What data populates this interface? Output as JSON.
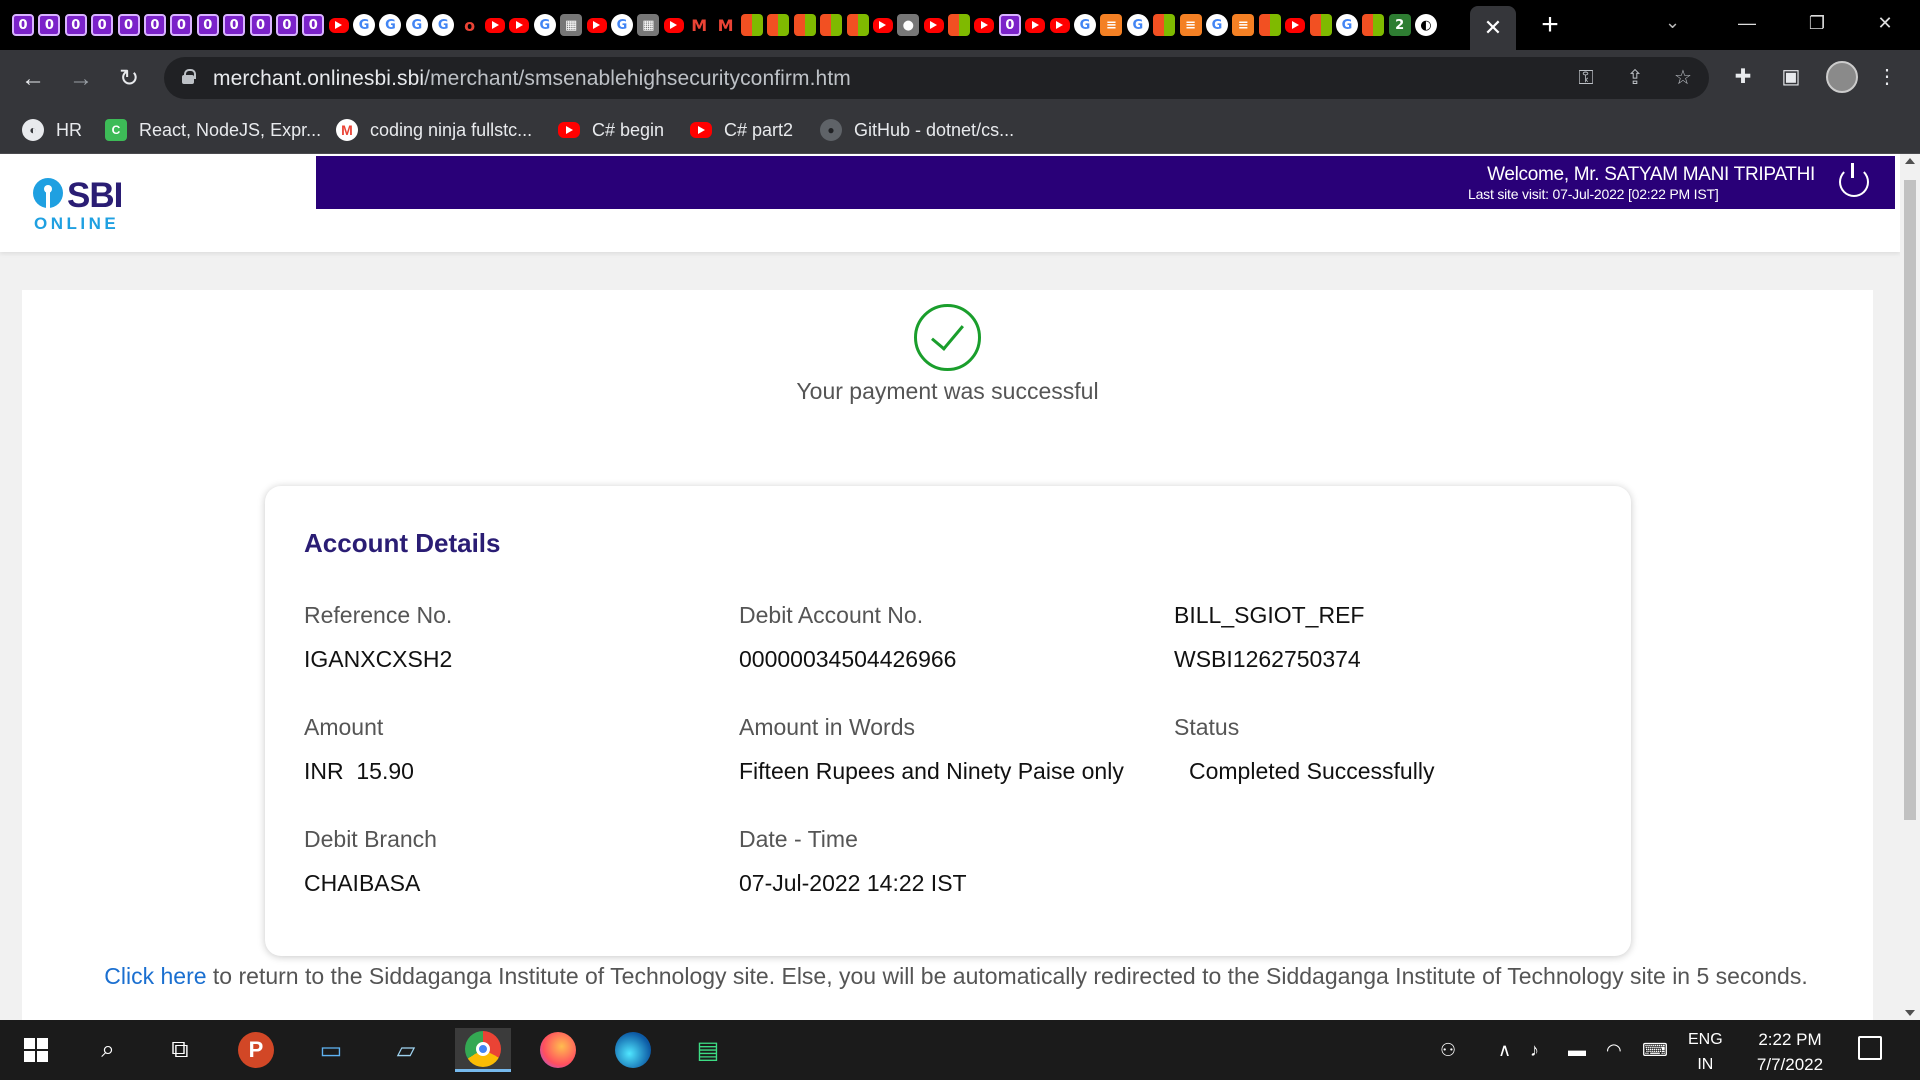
{
  "browser": {
    "tab_favicons": [
      "0",
      "0",
      "0",
      "0",
      "0",
      "0",
      "0",
      "0",
      "0",
      "0",
      "0",
      "0",
      "yt",
      "G",
      "G",
      "G",
      "G",
      "o",
      "yt",
      "yt",
      "G",
      "qr",
      "yt",
      "G",
      "qr",
      "yt",
      "M",
      "M",
      "ms",
      "ms",
      "ms",
      "ms",
      "ms",
      "yt",
      "gh",
      "yt",
      "ms",
      "yt",
      "0",
      "yt",
      "yt",
      "G",
      "so",
      "G",
      "ms",
      "so",
      "G",
      "so",
      "ms",
      "yt",
      "ms",
      "G",
      "ms",
      "2",
      "circle"
    ],
    "active_tab_close": "✕",
    "new_tab": "+",
    "tab_search": "⌄",
    "window_controls": {
      "minimize": "—",
      "restore": "❐",
      "close": "✕"
    },
    "nav": {
      "back": "←",
      "forward": "→",
      "reload": "↻"
    },
    "url_host": "merchant.onlinesbi.sbi",
    "url_path": "/merchant/smsenablehighsecurityconfirm.htm",
    "omnibox_icons": {
      "key": "⚿",
      "share": "⇪",
      "star": "☆"
    },
    "toolbar_icons": {
      "extensions": "✚",
      "sidepanel": "▣",
      "menu": "⋮"
    },
    "bookmarks": [
      {
        "icon": "globe",
        "label": "HR"
      },
      {
        "icon": "sheet",
        "label": "React, NodeJS, Expr..."
      },
      {
        "icon": "gmail",
        "label": "coding ninja fullstc..."
      },
      {
        "icon": "yt",
        "label": "C# begin"
      },
      {
        "icon": "yt",
        "label": "C# part2"
      },
      {
        "icon": "gh",
        "label": "GitHub - dotnet/cs..."
      }
    ]
  },
  "page": {
    "logo": {
      "brand": "SBI",
      "sub": "ONLINE"
    },
    "welcome": "Welcome, Mr. SATYAM MANI TRIPATHI",
    "last_visit": "Last site visit: 07-Jul-2022 [02:22 PM IST]",
    "success_message": "Your payment was successful",
    "details": {
      "title": "Account Details",
      "reference_label": "Reference No.",
      "reference_value": "IGANXCXSH2",
      "debit_account_label": "Debit Account No.",
      "debit_account_value": "00000034504426966",
      "bill_ref_label": "BILL_SGIOT_REF",
      "bill_ref_value": "WSBI1262750374",
      "amount_label": "Amount",
      "amount_value": "INR  15.90",
      "amount_words_label": "Amount in Words",
      "amount_words_value": "Fifteen Rupees and Ninety Paise only",
      "status_label": "Status",
      "status_value": "Completed Successfully",
      "branch_label": "Debit Branch",
      "branch_value": "CHAIBASA",
      "datetime_label": "Date - Time",
      "datetime_value": "07-Jul-2022 14:22 IST"
    },
    "redirect": {
      "link": "Click here",
      "text": " to return to the Siddaganga Institute of Technology site. Else, you will be automatically redirected to the Siddaganga Institute of Technology site in 5 seconds."
    }
  },
  "taskbar": {
    "apps": [
      "windows-start",
      "search",
      "task-view",
      "powerpoint",
      "this-pc",
      "notepad",
      "chrome",
      "firefox",
      "edge",
      "android-studio"
    ],
    "lang_top": "ENG",
    "lang_bottom": "IN",
    "time": "2:22 PM",
    "date": "7/7/2022"
  },
  "colors": {
    "sbi_purple": "#290078",
    "sbi_blue": "#1fa0e1",
    "success_green": "#1a9e2c",
    "link_blue": "#1a6fd0"
  }
}
